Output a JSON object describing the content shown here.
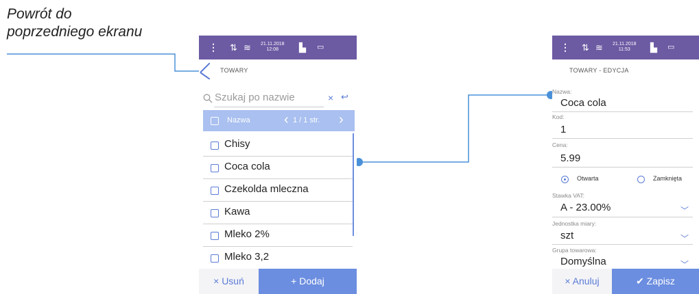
{
  "annotation": {
    "line1": "Powrót do",
    "line2": "poprzedniego ekranu"
  },
  "colors": {
    "statusbar": "#6c5aa3",
    "accent": "#5b7bd5",
    "header_row": "#a9c0f0",
    "primary_button": "#6c8ee0"
  },
  "screen1": {
    "status": {
      "date": "21.11.2018",
      "time": "12:08"
    },
    "title": "TOWARY",
    "search_placeholder": "Szukaj po nazwie",
    "clear_icon": "×",
    "swap_icon": "↩",
    "header": {
      "column": "Nazwa",
      "page": "1 / 1 str."
    },
    "rows": [
      "Chisy",
      "Coca cola",
      "Czekolda mleczna",
      "Kawa",
      "Mleko 2%",
      "Mleko 3,2"
    ],
    "delete_label": "× Usuń",
    "add_label": "+ Dodaj"
  },
  "screen2": {
    "status": {
      "date": "21.11.2018",
      "time": "11:53"
    },
    "title": "TOWARY - EDYCJA",
    "name_label": "Nazwa:",
    "name_value": "Coca cola",
    "code_label": "Kod:",
    "code_value": "1",
    "price_label": "Cena:",
    "price_value": "5.99",
    "radio_open": "Otwarta",
    "radio_closed": "Zamknięta",
    "vat_label": "Stawka VAT:",
    "vat_value": "A - 23.00%",
    "unit_label": "Jednostka miary:",
    "unit_value": "szt",
    "group_label": "Grupa towarowa:",
    "group_value": "Domyślna",
    "cancel_label": "× Anuluj",
    "save_label": "✔ Zapisz"
  }
}
